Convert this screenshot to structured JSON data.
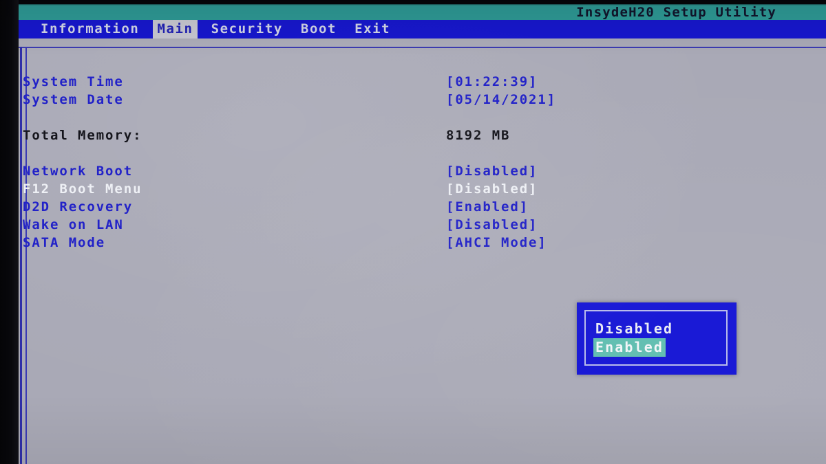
{
  "window": {
    "title": "InsydeH20 Setup Utility"
  },
  "menubar": {
    "items": [
      {
        "label": "Information",
        "active": false
      },
      {
        "label": "Main",
        "active": true
      },
      {
        "label": "Security",
        "active": false
      },
      {
        "label": "Boot",
        "active": false
      },
      {
        "label": "Exit",
        "active": false
      }
    ]
  },
  "main": {
    "rows": [
      {
        "label": "System Time",
        "value": "[01:22:39]",
        "label_color": "blue",
        "value_color": "blue"
      },
      {
        "label": "System Date",
        "value": "[05/14/2021]",
        "label_color": "blue",
        "value_color": "blue"
      },
      {
        "label": "Total Memory:",
        "value": "8192 MB",
        "label_color": "dark",
        "value_color": "dark"
      },
      {
        "label": "Network Boot",
        "value": "[Disabled]",
        "label_color": "blue",
        "value_color": "blue"
      },
      {
        "label": "F12 Boot Menu",
        "value": "[Disabled]",
        "label_color": "white",
        "value_color": "white"
      },
      {
        "label": "D2D Recovery",
        "value": "[Enabled]",
        "label_color": "blue",
        "value_color": "blue"
      },
      {
        "label": "Wake on LAN",
        "value": "[Disabled]",
        "label_color": "blue",
        "value_color": "blue"
      },
      {
        "label": "SATA Mode",
        "value": "[AHCI Mode]",
        "label_color": "blue",
        "value_color": "blue"
      }
    ]
  },
  "popup": {
    "options": [
      {
        "label": "Disabled",
        "selected": false
      },
      {
        "label": "Enabled",
        "selected": true
      }
    ]
  },
  "colors": {
    "titlebar_teal": "#2e9a96",
    "menubar_blue": "#1717cf",
    "page_gray": "#a9a9b6",
    "text_blue": "#2222c8",
    "highlight_teal": "#63bfb2",
    "popup_blue": "#1a1ad6"
  }
}
